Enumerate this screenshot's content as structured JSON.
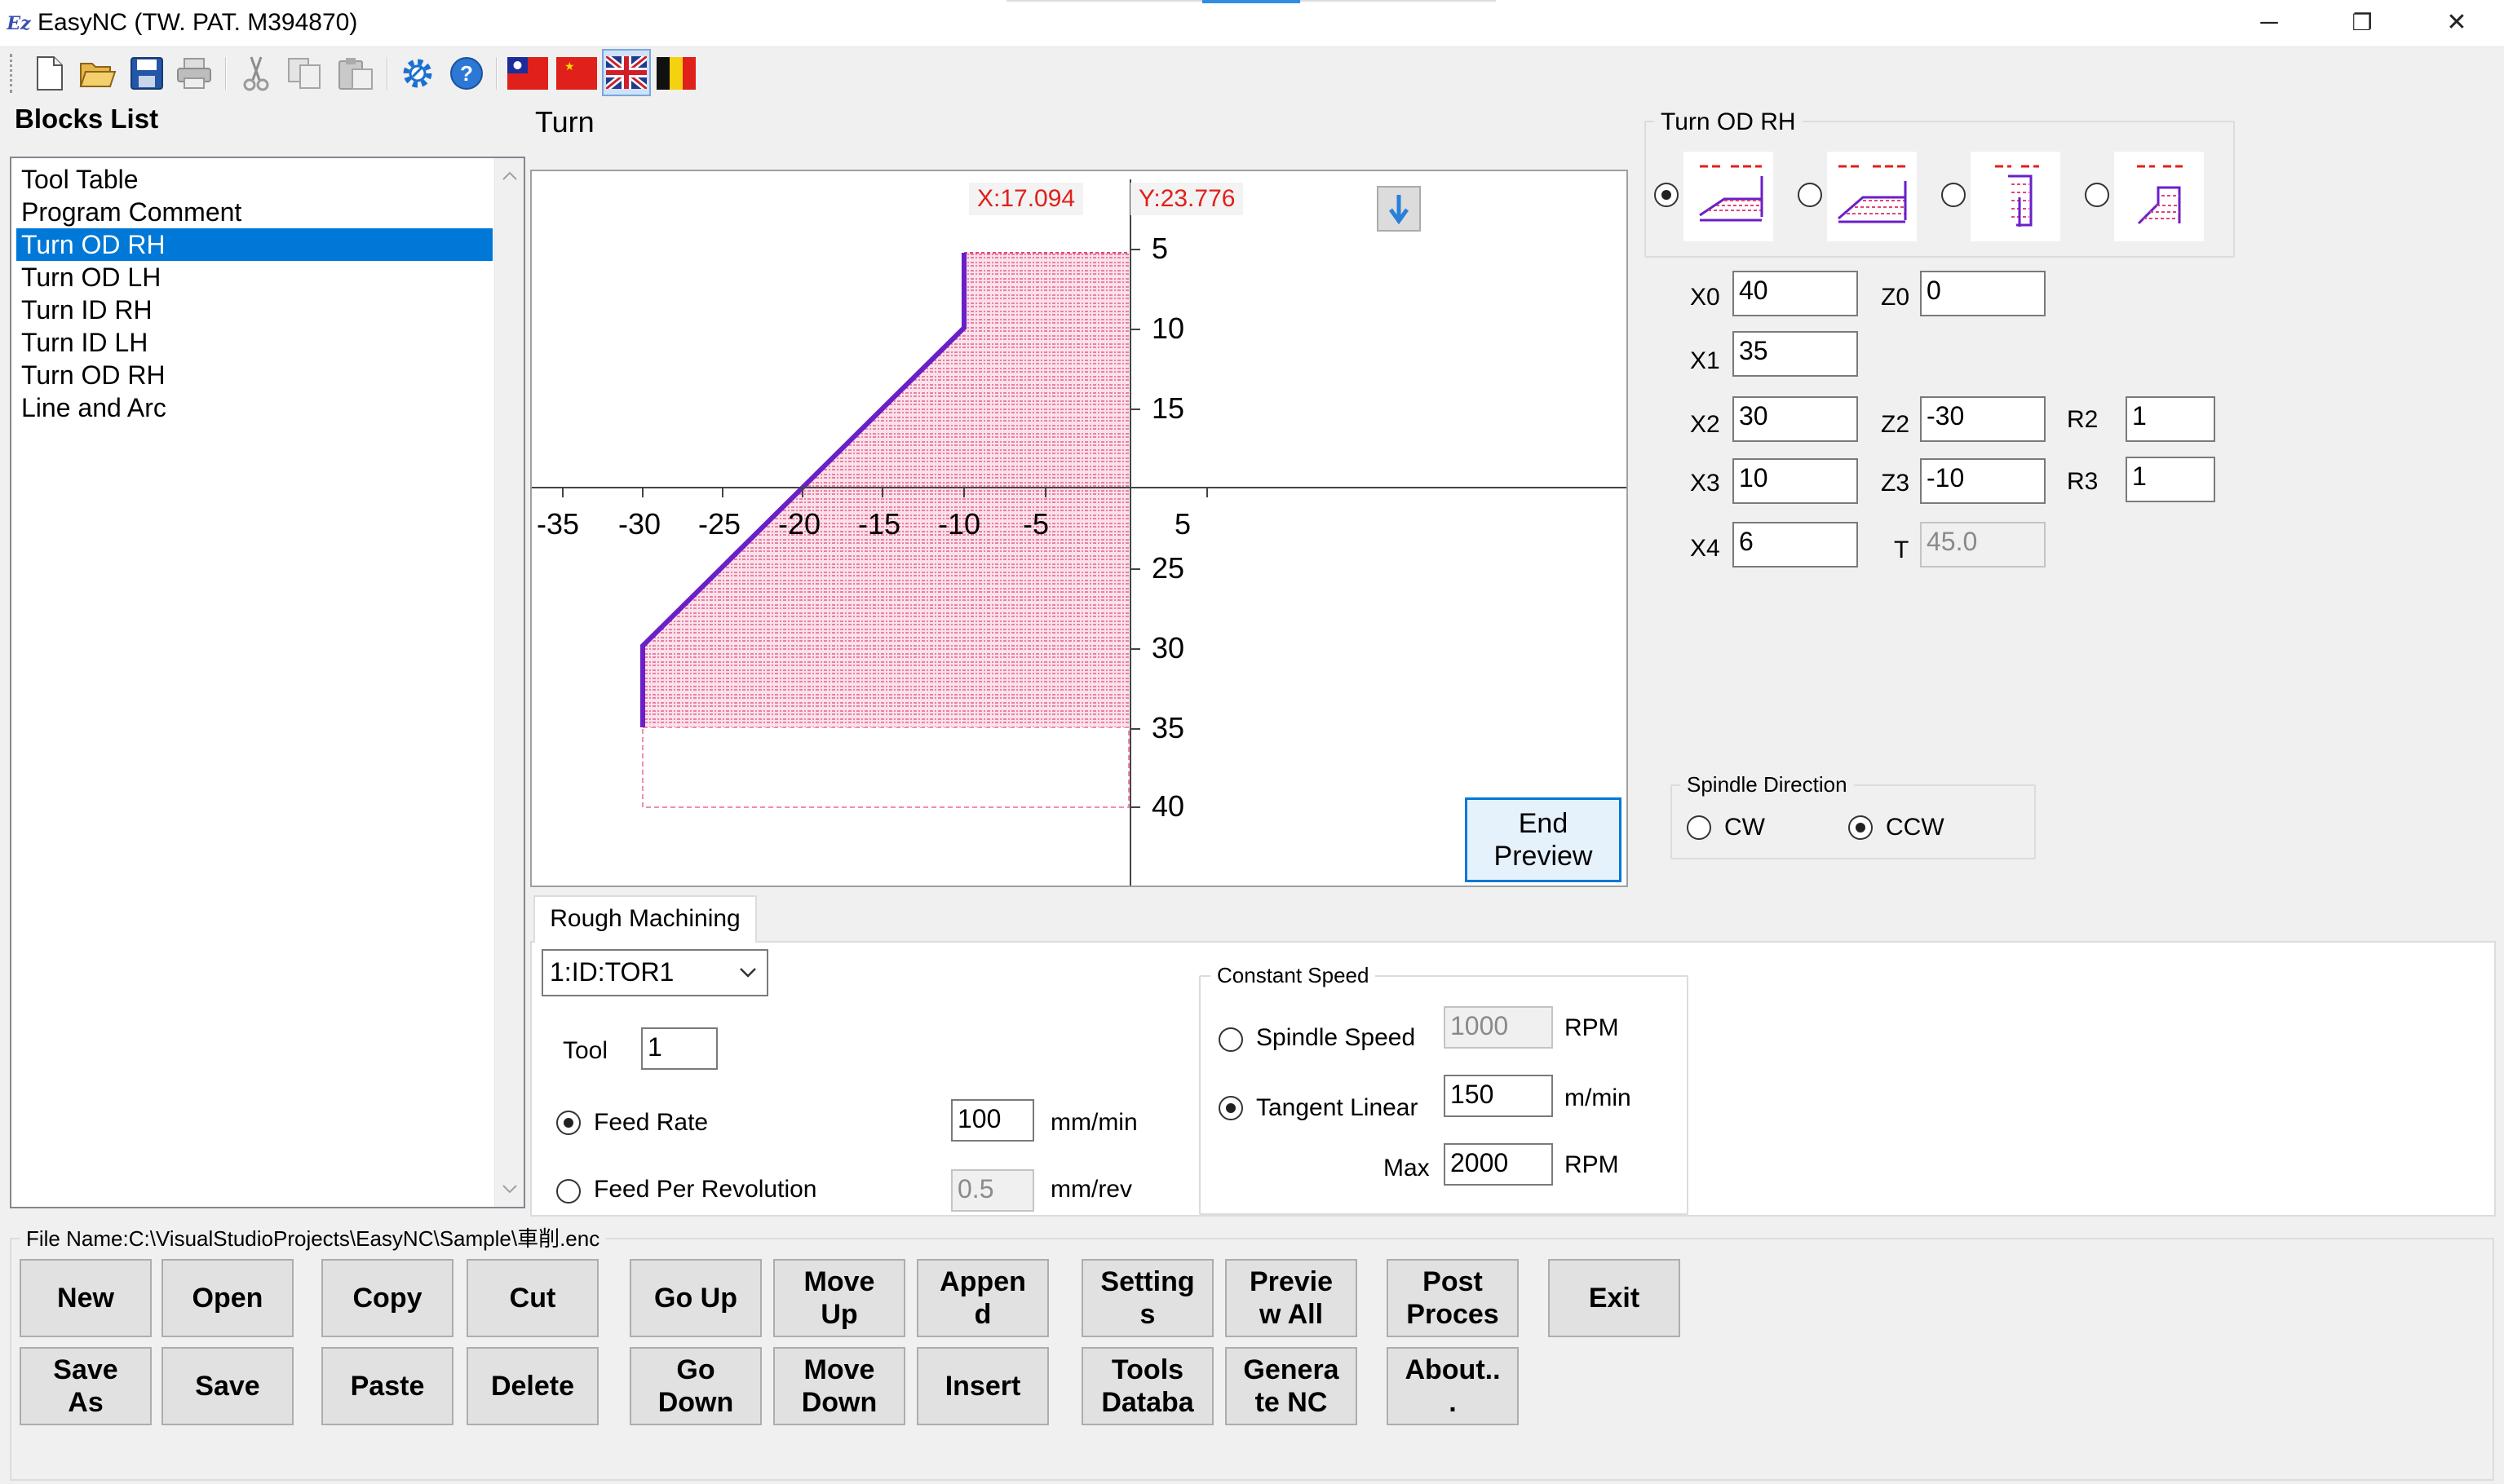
{
  "window": {
    "title": "EasyNC  (TW. PAT. M394870)",
    "minimize": "─",
    "restore": "❐",
    "close": "✕"
  },
  "toolbar": {
    "icons": [
      "new-file-icon",
      "open-folder-icon",
      "save-disk-icon",
      "print-icon",
      "cut-icon",
      "copy-icon",
      "paste-icon",
      "settings-gear-icon",
      "help-icon",
      "flag-taiwan-icon",
      "flag-china-icon",
      "flag-uk-icon",
      "flag-belgium-icon"
    ]
  },
  "blocks_list": {
    "title": "Blocks List",
    "items": [
      "Tool Table",
      "Program Comment",
      "Turn OD RH",
      "Turn OD LH",
      "Turn ID RH",
      "Turn ID LH",
      "Turn OD RH",
      "Line and Arc"
    ],
    "selected_index": 2
  },
  "preview": {
    "title": "Turn",
    "coord_x": "X:17.094",
    "coord_y": "Y:23.776",
    "x_ticks": [
      "-35",
      "-30",
      "-25",
      "-20",
      "-15",
      "-10",
      "-5",
      "5"
    ],
    "y_ticks": [
      "5",
      "10",
      "15",
      "25",
      "30",
      "35",
      "40"
    ],
    "end_preview": "End\nPreview",
    "accent_color": "#7b00c8",
    "fill_color": "#e0457b"
  },
  "rough": {
    "tab_label": "Rough Machining",
    "tool_select": "1:ID:TOR1",
    "tool_label": "Tool",
    "tool_value": "1",
    "feed_rate_label": "Feed Rate",
    "feed_rate_value": "100",
    "feed_rate_unit": "mm/min",
    "feed_per_rev_label": "Feed Per Revolution",
    "feed_per_rev_value": "0.5",
    "feed_per_rev_unit": "mm/rev",
    "constant_speed": {
      "title": "Constant Speed",
      "spindle_speed_label": "Spindle Speed",
      "spindle_speed_value": "1000",
      "spindle_speed_unit": "RPM",
      "tangent_linear_label": "Tangent Linear",
      "tangent_linear_value": "150",
      "tangent_linear_unit": "m/min",
      "max_label": "Max",
      "max_value": "2000",
      "max_unit": "RPM"
    }
  },
  "params": {
    "title": "Turn OD RH",
    "x0_label": "X0",
    "x0": "40",
    "z0_label": "Z0",
    "z0": "0",
    "x1_label": "X1",
    "x1": "35",
    "x2_label": "X2",
    "x2": "30",
    "z2_label": "Z2",
    "z2": "-30",
    "r2_label": "R2",
    "r2": "1",
    "x3_label": "X3",
    "x3": "10",
    "z3_label": "Z3",
    "z3": "-10",
    "r3_label": "R3",
    "r3": "1",
    "x4_label": "X4",
    "x4": "6",
    "t_label": "T",
    "t": "45.0"
  },
  "spindle": {
    "title": "Spindle Direction",
    "cw": "CW",
    "ccw": "CCW"
  },
  "file": {
    "label": "File Name:C:\\VisualStudioProjects\\EasyNC\\Sample\\車削.enc"
  },
  "buttons": {
    "new": "New",
    "open": "Open",
    "copy": "Copy",
    "cut": "Cut",
    "go_up": "Go Up",
    "move_up": "Move\nUp",
    "append": "Appen\nd",
    "settings": "Setting\ns",
    "preview_all": "Previe\nw All",
    "post_process": "Post\nProces",
    "exit": "Exit",
    "save_as": "Save\nAs",
    "save": "Save",
    "paste": "Paste",
    "delete": "Delete",
    "go_down": "Go\nDown",
    "move_down": "Move\nDown",
    "insert": "Insert",
    "tools_database": "Tools\nDataba",
    "generate_nc": "Genera\nte NC",
    "about": "About..\n."
  }
}
